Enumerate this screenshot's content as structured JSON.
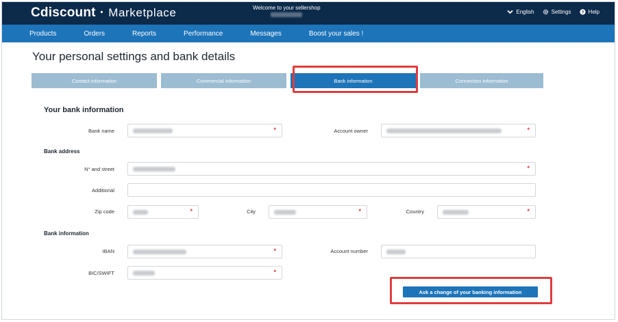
{
  "brand": {
    "name": "Cdiscount",
    "separator": "·",
    "product": "Marketplace"
  },
  "header": {
    "welcome": "Welcome to your sellershop"
  },
  "top_links": {
    "language": "English",
    "settings": "Settings",
    "help": "Help"
  },
  "nav": [
    "Products",
    "Orders",
    "Reports",
    "Performance",
    "Messages",
    "Boost your sales !"
  ],
  "page": {
    "title": "Your personal settings and bank details"
  },
  "tabs": [
    {
      "label": "Contact information",
      "active": false
    },
    {
      "label": "Commercial information",
      "active": false
    },
    {
      "label": "Bank information",
      "active": true
    },
    {
      "label": "Connection information",
      "active": false
    }
  ],
  "form": {
    "section_title": "Your bank information",
    "bank_name_label": "Bank name",
    "account_owner_label": "Account owner",
    "bank_address_title": "Bank address",
    "street_label": "N° and street",
    "additional_label": "Additional",
    "zip_label": "Zip code",
    "city_label": "City",
    "country_label": "Country",
    "bank_information_title": "Bank information",
    "iban_label": "IBAN",
    "account_number_label": "Account number",
    "bic_label": "BIC/SWIFT",
    "required_mark": "*"
  },
  "actions": {
    "ask_change": "Ask a change of your banking information"
  },
  "colors": {
    "topbar": "#0c2a4a",
    "navbar": "#1d74b9",
    "tab_inactive": "#9cbcd2",
    "tab_active": "#1d74b9",
    "highlight": "#e03c3c",
    "required": "#e0363c"
  }
}
